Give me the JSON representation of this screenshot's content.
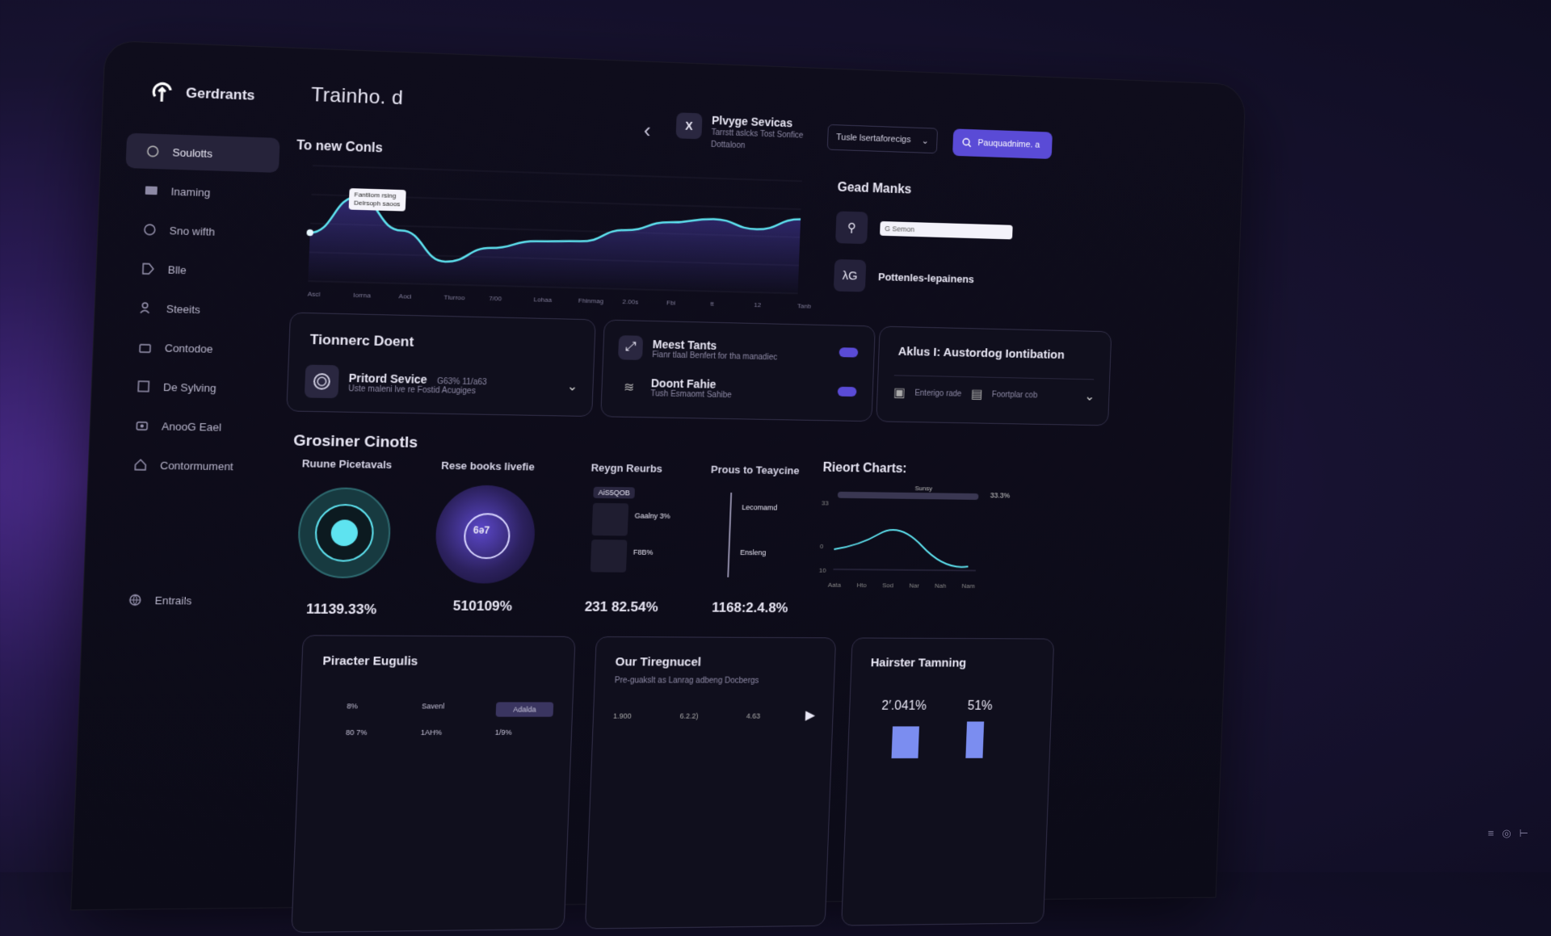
{
  "brand": {
    "name": "Gerdrants"
  },
  "header": {
    "title": "Trainho. d",
    "service": {
      "icon_text": "X",
      "title": "Plvyge Sevicas",
      "subtitle": "Tarrstt aslcks Tost Sonfice Dottaloon"
    },
    "dropdown_label": "Tusle lsertaforecigs",
    "primary_button": "Pauquadnime. a"
  },
  "sidebar": {
    "items": [
      {
        "label": "Soulotts",
        "icon": "chat-icon"
      },
      {
        "label": "Inaming",
        "icon": "folder-icon"
      },
      {
        "label": "Sno wifth",
        "icon": "help-icon"
      },
      {
        "label": "Blle",
        "icon": "tag-icon"
      },
      {
        "label": "Steeits",
        "icon": "users-icon"
      },
      {
        "label": "Contodoe",
        "icon": "briefcase-icon"
      },
      {
        "label": "De Sylving",
        "icon": "square-icon"
      },
      {
        "label": "AnooG Eael",
        "icon": "camera-icon"
      },
      {
        "label": "Contormument",
        "icon": "house-icon"
      }
    ],
    "footer_label": "Entrails"
  },
  "main_chart": {
    "title": "To new Conls",
    "tooltip": [
      "Fantliom rsing",
      "Delrsoph saoos"
    ],
    "x_labels": [
      "Ascl",
      "Iorrna",
      "Aoci",
      "Tlurroo",
      "7/00",
      "Lohaa",
      "Fhinmag",
      "2.00s",
      "Fbi",
      "tt",
      "12",
      "Tanb"
    ]
  },
  "chart_data": {
    "type": "area",
    "title": "To new Conls",
    "x": [
      0,
      1,
      2,
      3,
      4,
      5,
      6,
      7,
      8,
      9,
      10,
      11
    ],
    "series": [
      {
        "values": [
          42,
          74,
          46,
          20,
          33,
          40,
          41,
          52,
          60,
          64,
          56,
          66
        ]
      }
    ],
    "ylim": [
      0,
      100
    ]
  },
  "good_marks": {
    "title": "Gead Manks",
    "input_placeholder": "G Semon",
    "item_label": "Pottenles-lepainens",
    "item_icon_text": "λG"
  },
  "card1": {
    "title": "Tionnerc Doent",
    "item_title": "Pritord Sevice",
    "item_meta": "G63%   11/a63",
    "item_sub": "Uste maleni lve re Fostid Acugiges"
  },
  "card2": {
    "item1_title": "Meest Tants",
    "item1_sub": "Fianr tlaal Benfert for tha manadiec",
    "item2_title": "Doont Fahie",
    "item2_sub": "Tush Esmaomt Sahibe"
  },
  "card3": {
    "title": "Aklus I: Austordog Iontibation",
    "opt1": "Enterigo rade",
    "opt2": "Foortplar cob"
  },
  "growth": {
    "title": "Grosiner Cinotls",
    "stats": [
      {
        "label": "Ruune Picetavals",
        "value": "11139.33%"
      },
      {
        "label": "Rese books livefie",
        "value": "510109%",
        "badge": "6ə7"
      },
      {
        "label": "Reygn Reurbs",
        "value": "231 82.54%",
        "chip1": "AiS5QOB",
        "chip2": "Gaalny 3%",
        "chip3": "F8B%"
      },
      {
        "label": "Prous to Teaycine",
        "value": "1168:2.4.8%",
        "tick1": "Lecomamd",
        "tick2": "Ensleng"
      }
    ]
  },
  "recent_charts": {
    "title": "Rieort Charts:",
    "bar_label": "Sunsy",
    "bar_value": "33.3%",
    "y_labels": [
      "33",
      "0",
      "10"
    ],
    "x_labels": [
      "Aata",
      "Hto",
      "Sod",
      "Nar",
      "Nah",
      "Nam"
    ]
  },
  "bottom": {
    "card1": {
      "title": "Piracter Eugulis",
      "cells": [
        "8%",
        "Savenl",
        "Adalda",
        "80 7%",
        "1AH%",
        "1/9%"
      ]
    },
    "card2": {
      "title": "Our Tiregnucel",
      "sub": "Pre-guakslt as Lanrag adbeng Docbergs",
      "values": [
        "1.900",
        "6.2.2)",
        "4.63"
      ]
    },
    "card3": {
      "title": "Hairster Tamning",
      "v1": "2′.041%",
      "v2": "51%"
    }
  },
  "colors": {
    "accent": "#5a4bd6",
    "teal": "#5ee3f0",
    "bg": "#0e0d1b"
  }
}
